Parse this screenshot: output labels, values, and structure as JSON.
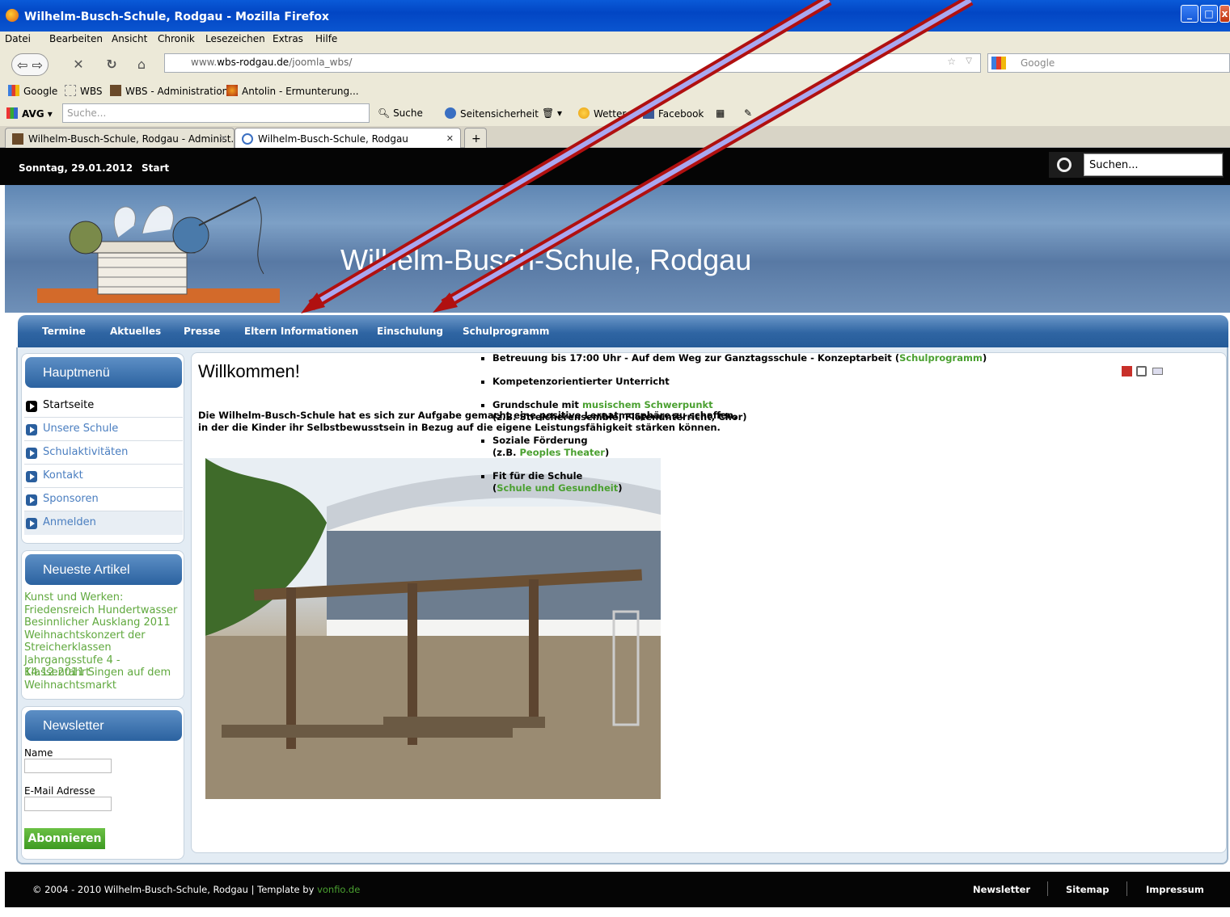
{
  "window": {
    "title": "Wilhelm-Busch-Schule, Rodgau - Mozilla Firefox"
  },
  "menubar": [
    "Datei",
    "Bearbeiten",
    "Ansicht",
    "Chronik",
    "Lesezeichen",
    "Extras",
    "Hilfe"
  ],
  "navbar": {
    "url_prefix": "www.",
    "url_host": "wbs-rodgau.de",
    "url_path": "/joomla_wbs/",
    "search_placeholder": "Google"
  },
  "bookmarks": [
    "Google",
    "WBS",
    "WBS - Administration",
    "Antolin - Ermunterung..."
  ],
  "avgbar": {
    "logo": "AVG",
    "search_placeholder": "Suche...",
    "search_button": "Suche",
    "security": "Seitensicherheit",
    "weather": "Wetter",
    "facebook": "Facebook"
  },
  "tabs": [
    {
      "label": "Wilhelm-Busch-Schule, Rodgau - Administ..."
    },
    {
      "label": "Wilhelm-Busch-Schule, Rodgau"
    }
  ],
  "site": {
    "date": "Sonntag, 29.01.2012",
    "start": "Start",
    "search_placeholder": "Suchen...",
    "banner_title": "Wilhelm-Busch-Schule, Rodgau",
    "main_nav": [
      "Termine",
      "Aktuelles",
      "Presse",
      "Eltern Informationen",
      "Einschulung",
      "Schulprogramm"
    ]
  },
  "sidebar": {
    "hauptmenu_title": "Hauptmenü",
    "hauptmenu": [
      "Startseite",
      "Unsere Schule",
      "Schulaktivitäten",
      "Kontakt",
      "Sponsoren",
      "Anmelden"
    ],
    "articles_title": "Neueste Artikel",
    "articles": [
      "Kunst und Werken:",
      "Friedensreich Hundertwasser",
      "Besinnlicher Ausklang 2011",
      "Weihnachtskonzert der",
      "Streicherklassen",
      "Jahrgangsstufe 4 - Klassenfahrt",
      "14.12.2011 Singen auf dem",
      "Weihnachtsmarkt"
    ],
    "newsletter_title": "Newsletter",
    "name_label": "Name",
    "email_label": "E-Mail Adresse",
    "subscribe": "Abonnieren"
  },
  "content": {
    "heading": "Willkommen!",
    "intro_line1": "Die Wilhelm-Busch-Schule hat es sich zur Aufgabe gemacht eine positive Lernatmosphäre zu schaffen,",
    "intro_line2": "in der die Kinder ihr Selbstbewusstsein in Bezug auf die eigene Leistungsfähigkeit stärken können.",
    "bullets": {
      "b1_text": "Betreuung bis 17:00 Uhr - Auf dem Weg zur Ganztagsschule - Konzeptarbeit (",
      "b1_link": "Schulprogramm",
      "b1_end": ")",
      "b2_text": "Kompetenzorientierter Unterricht",
      "b3_text": "Grundschule mit ",
      "b3_link": "musischem Schwerpunkt",
      "b3_line2": "(z.B. Streicherensemble, Flötenunterricht, Chor)",
      "b4_text": "Soziale Förderung",
      "b4_pre": "(z.B. ",
      "b4_link": "Peoples Theater",
      "b4_end": ")",
      "b5_text": "Fit für die Schule",
      "b5_pre": "(",
      "b5_link": "Schule und Gesundheit",
      "b5_end": ")"
    }
  },
  "footer": {
    "copyright": "© 2004 - 2010 Wilhelm-Busch-Schule, Rodgau | Template by ",
    "template_link": "vonfio.de",
    "links": [
      "Newsletter",
      "Sitemap",
      "Impressum"
    ]
  },
  "colors": {
    "link_green": "#4aa030",
    "nav_blue": "#2f65a3",
    "annotation_arrow": "#b01010"
  }
}
